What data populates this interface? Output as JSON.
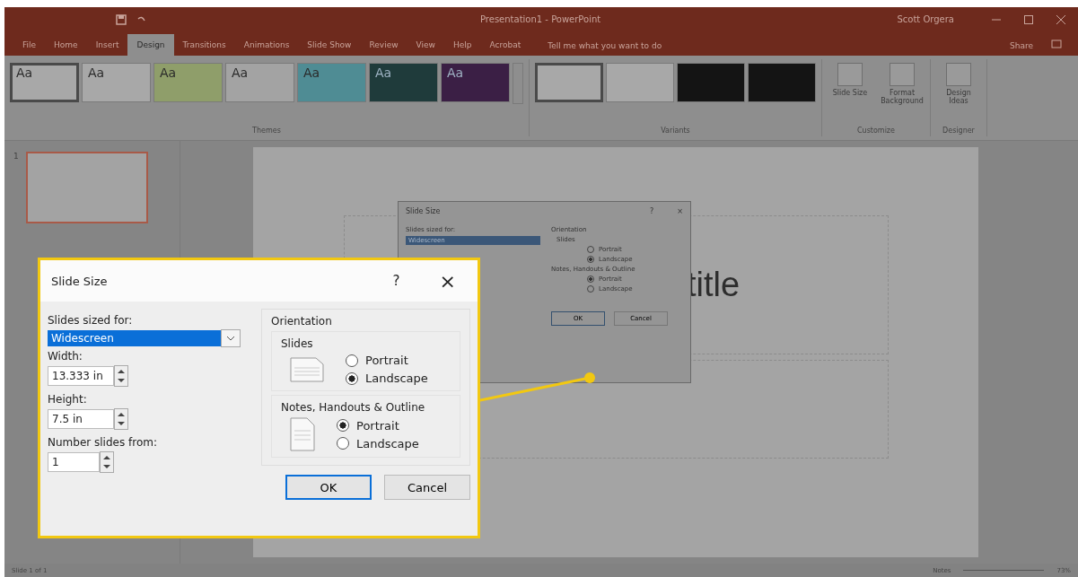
{
  "window": {
    "title": "Presentation1 - PowerPoint",
    "user": "Scott Orgera"
  },
  "ribbon_tabs": [
    {
      "label": "File",
      "selected": false
    },
    {
      "label": "Home",
      "selected": false
    },
    {
      "label": "Insert",
      "selected": false
    },
    {
      "label": "Design",
      "selected": true
    },
    {
      "label": "Transitions",
      "selected": false
    },
    {
      "label": "Animations",
      "selected": false
    },
    {
      "label": "Slide Show",
      "selected": false
    },
    {
      "label": "Review",
      "selected": false
    },
    {
      "label": "View",
      "selected": false
    },
    {
      "label": "Help",
      "selected": false
    },
    {
      "label": "Acrobat",
      "selected": false
    }
  ],
  "tell_me": "Tell me what you want to do",
  "share": "Share",
  "themes": {
    "label": "Themes",
    "items": [
      {
        "label": "Aa",
        "color": "#a8a8a8",
        "selected": true
      },
      {
        "label": "Aa",
        "color": "#a8a8a8",
        "selected": false
      },
      {
        "label": "Aa",
        "color": "#8f9e6a",
        "selected": false
      },
      {
        "label": "Aa",
        "color": "#a3a3a3",
        "selected": false
      },
      {
        "label": "Aa",
        "color": "#4f8c94",
        "selected": false
      },
      {
        "label": "Aa",
        "color": "#1f3b3b",
        "selected": false,
        "kind": "dark"
      },
      {
        "label": "Aa",
        "color": "#3b1f45",
        "selected": false,
        "kind": "dark"
      }
    ]
  },
  "variants": {
    "label": "Variants",
    "items": [
      {
        "color": "#a8a8a8",
        "selected": true
      },
      {
        "color": "#a8a8a8",
        "selected": false
      },
      {
        "color": "#141414",
        "selected": false
      },
      {
        "color": "#141414",
        "selected": false
      }
    ]
  },
  "customize": {
    "label": "Customize",
    "buttons": [
      "Slide Size",
      "Format Background"
    ]
  },
  "designer": {
    "label": "Designer",
    "buttons": [
      "Design Ideas"
    ]
  },
  "slides_panel": [
    {
      "number": "1",
      "selected": true
    }
  ],
  "slide": {
    "title_fragment": "title"
  },
  "status_bar": {
    "slide_count": "Slide 1 of 1",
    "notes": "Notes",
    "zoom": "73%"
  },
  "small_dialog": {
    "title": "Slide Size",
    "help": "?",
    "close": "×",
    "sized_for_label": "Slides sized for:",
    "sized_for": "Widescreen",
    "orientation": "Orientation",
    "slides": "Slides",
    "slides_options": [
      {
        "label": "Portrait",
        "selected": false
      },
      {
        "label": "Landscape",
        "selected": true
      }
    ],
    "notes": "Notes, Handouts & Outline",
    "notes_options": [
      {
        "label": "Portrait",
        "selected": true
      },
      {
        "label": "Landscape",
        "selected": false
      }
    ],
    "ok": "OK",
    "cancel": "Cancel"
  },
  "callout_dialog": {
    "title": "Slide Size",
    "help": "?",
    "close": "×",
    "sized_for_label": "Slides sized for:",
    "sized_for": "Widescreen",
    "width_label": "Width:",
    "width": "13.333 in",
    "height_label": "Height:",
    "height": "7.5 in",
    "number_label": "Number slides from:",
    "number": "1",
    "orientation": "Orientation",
    "slides": "Slides",
    "slides_options": [
      {
        "label": "Portrait",
        "selected": false
      },
      {
        "label": "Landscape",
        "selected": true
      }
    ],
    "notes": "Notes, Handouts & Outline",
    "notes_options": [
      {
        "label": "Portrait",
        "selected": true
      },
      {
        "label": "Landscape",
        "selected": false
      }
    ],
    "ok": "OK",
    "cancel": "Cancel"
  }
}
